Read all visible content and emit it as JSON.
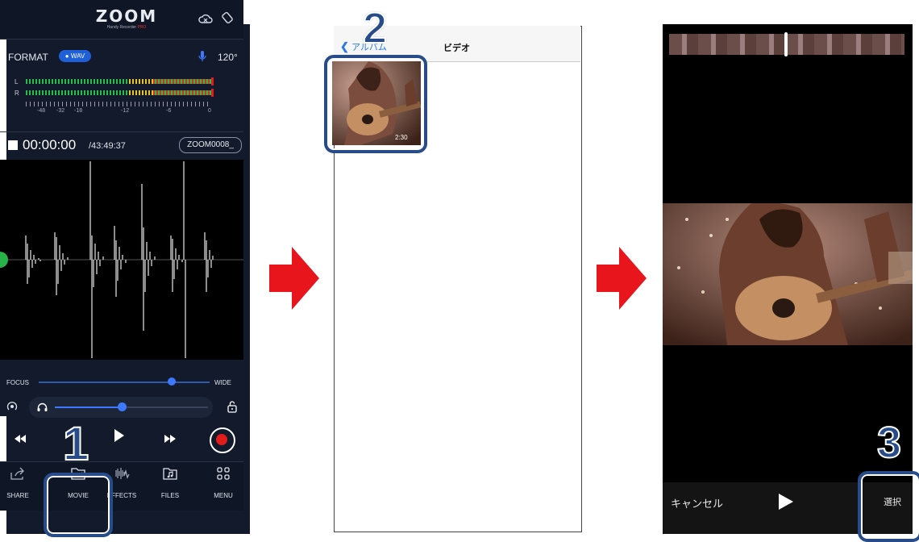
{
  "recorder": {
    "logo_text": "ZOOM",
    "logo_sub": "Handy Recorder",
    "logo_sub_accent": "PRO",
    "format_label": "FORMAT",
    "format_value": "● WAV",
    "tempo": "120°",
    "meter_channels": [
      "L",
      "R"
    ],
    "meter_scale": [
      "-48",
      "-32",
      "-18",
      "-12",
      "-6",
      "0"
    ],
    "time": "00:00:00",
    "total_time": "/43:49:37",
    "file_name": "ZOOM0008_",
    "focus_label": "FOCUS",
    "wide_label": "WIDE",
    "focus_level": 0.8,
    "volume_level": 0.45,
    "tabs": [
      {
        "label": "SHARE",
        "icon": "share-icon"
      },
      {
        "label": "MOVIE",
        "icon": "folder-movie-icon"
      },
      {
        "label": "EFFECTS",
        "icon": "effects-icon"
      },
      {
        "label": "FILES",
        "icon": "folder-music-icon"
      },
      {
        "label": "MENU",
        "icon": "menu-grid-icon"
      }
    ]
  },
  "picker": {
    "back_label": "アルバム",
    "title": "ビデオ",
    "video_duration": "2:30"
  },
  "editor": {
    "cancel_label": "キャンセル",
    "select_label": "選択"
  },
  "callouts": [
    "1",
    "2",
    "3"
  ],
  "colors": {
    "callout": "#274c89",
    "arrow": "#e8151c",
    "accent_blue": "#3d79ff",
    "record_red": "#e21b1b"
  }
}
